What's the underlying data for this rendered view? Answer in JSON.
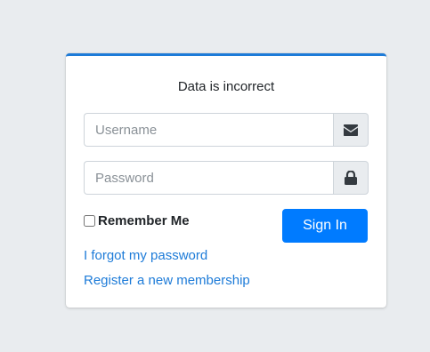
{
  "login": {
    "message": "Data is incorrect",
    "username": {
      "placeholder": "Username",
      "value": "",
      "icon": "envelope-icon"
    },
    "password": {
      "placeholder": "Password",
      "value": "",
      "icon": "lock-icon"
    },
    "remember_label": "Remember Me",
    "remember_checked": false,
    "signin_label": "Sign In",
    "forgot_link": "I forgot my password",
    "register_link": "Register a new membership"
  },
  "colors": {
    "accent": "#1d7bd8",
    "button": "#007bff",
    "background": "#e9ecef"
  }
}
